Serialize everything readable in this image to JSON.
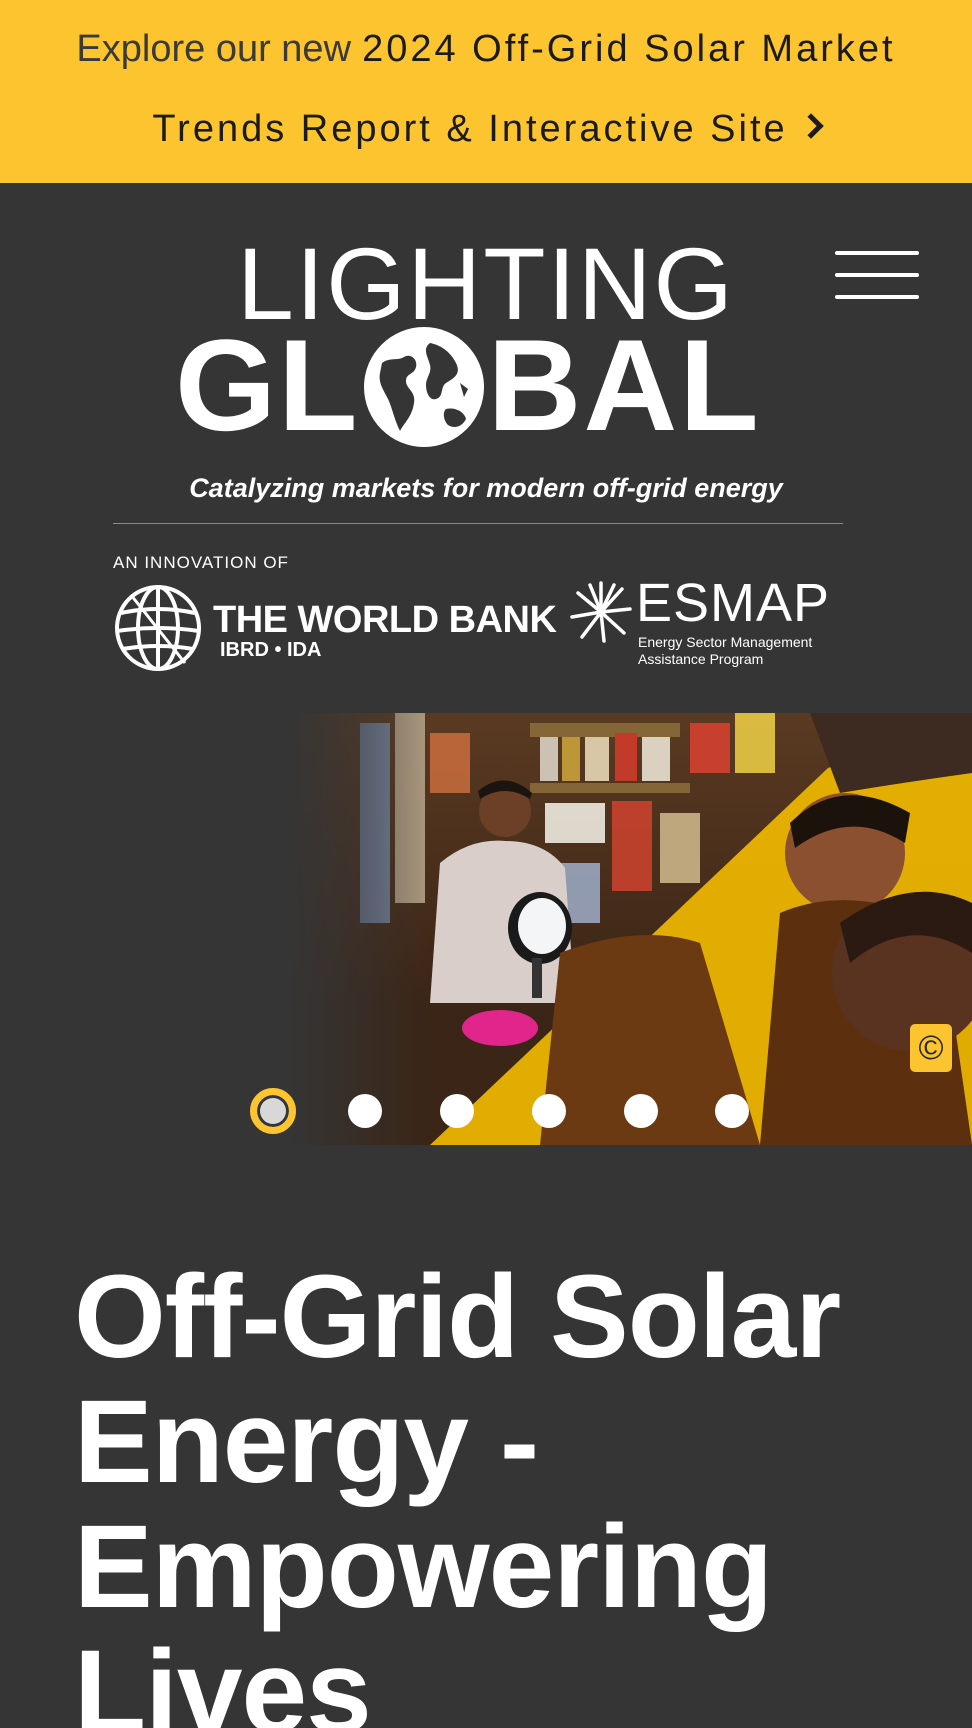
{
  "banner": {
    "lead": "Explore our new",
    "rest": "2024 Off-Grid Solar Market",
    "line2": "Trends Report & Interactive Site",
    "chevron_icon": "chevron-right-icon",
    "background": "#fcc42e"
  },
  "header": {
    "menu_icon": "hamburger-menu-icon",
    "logo": {
      "top": "LIGHTING",
      "main_left": "GL",
      "main_right": "BAL",
      "tagline": "Catalyzing markets for modern off-grid energy"
    },
    "innovation_label": "AN INNOVATION OF",
    "world_bank": {
      "name": "THE WORLD BANK",
      "sub": "IBRD • IDA"
    },
    "esmap": {
      "name": "ESMAP",
      "sub_line1": "Energy Sector Management",
      "sub_line2": "Assistance Program"
    }
  },
  "hero": {
    "copyright_symbol": "©",
    "slides_count": 6,
    "active_slide": 1,
    "accent": "#fcc42e"
  },
  "main": {
    "headline": "Off-Grid Solar Energy - Empowering Lives"
  }
}
